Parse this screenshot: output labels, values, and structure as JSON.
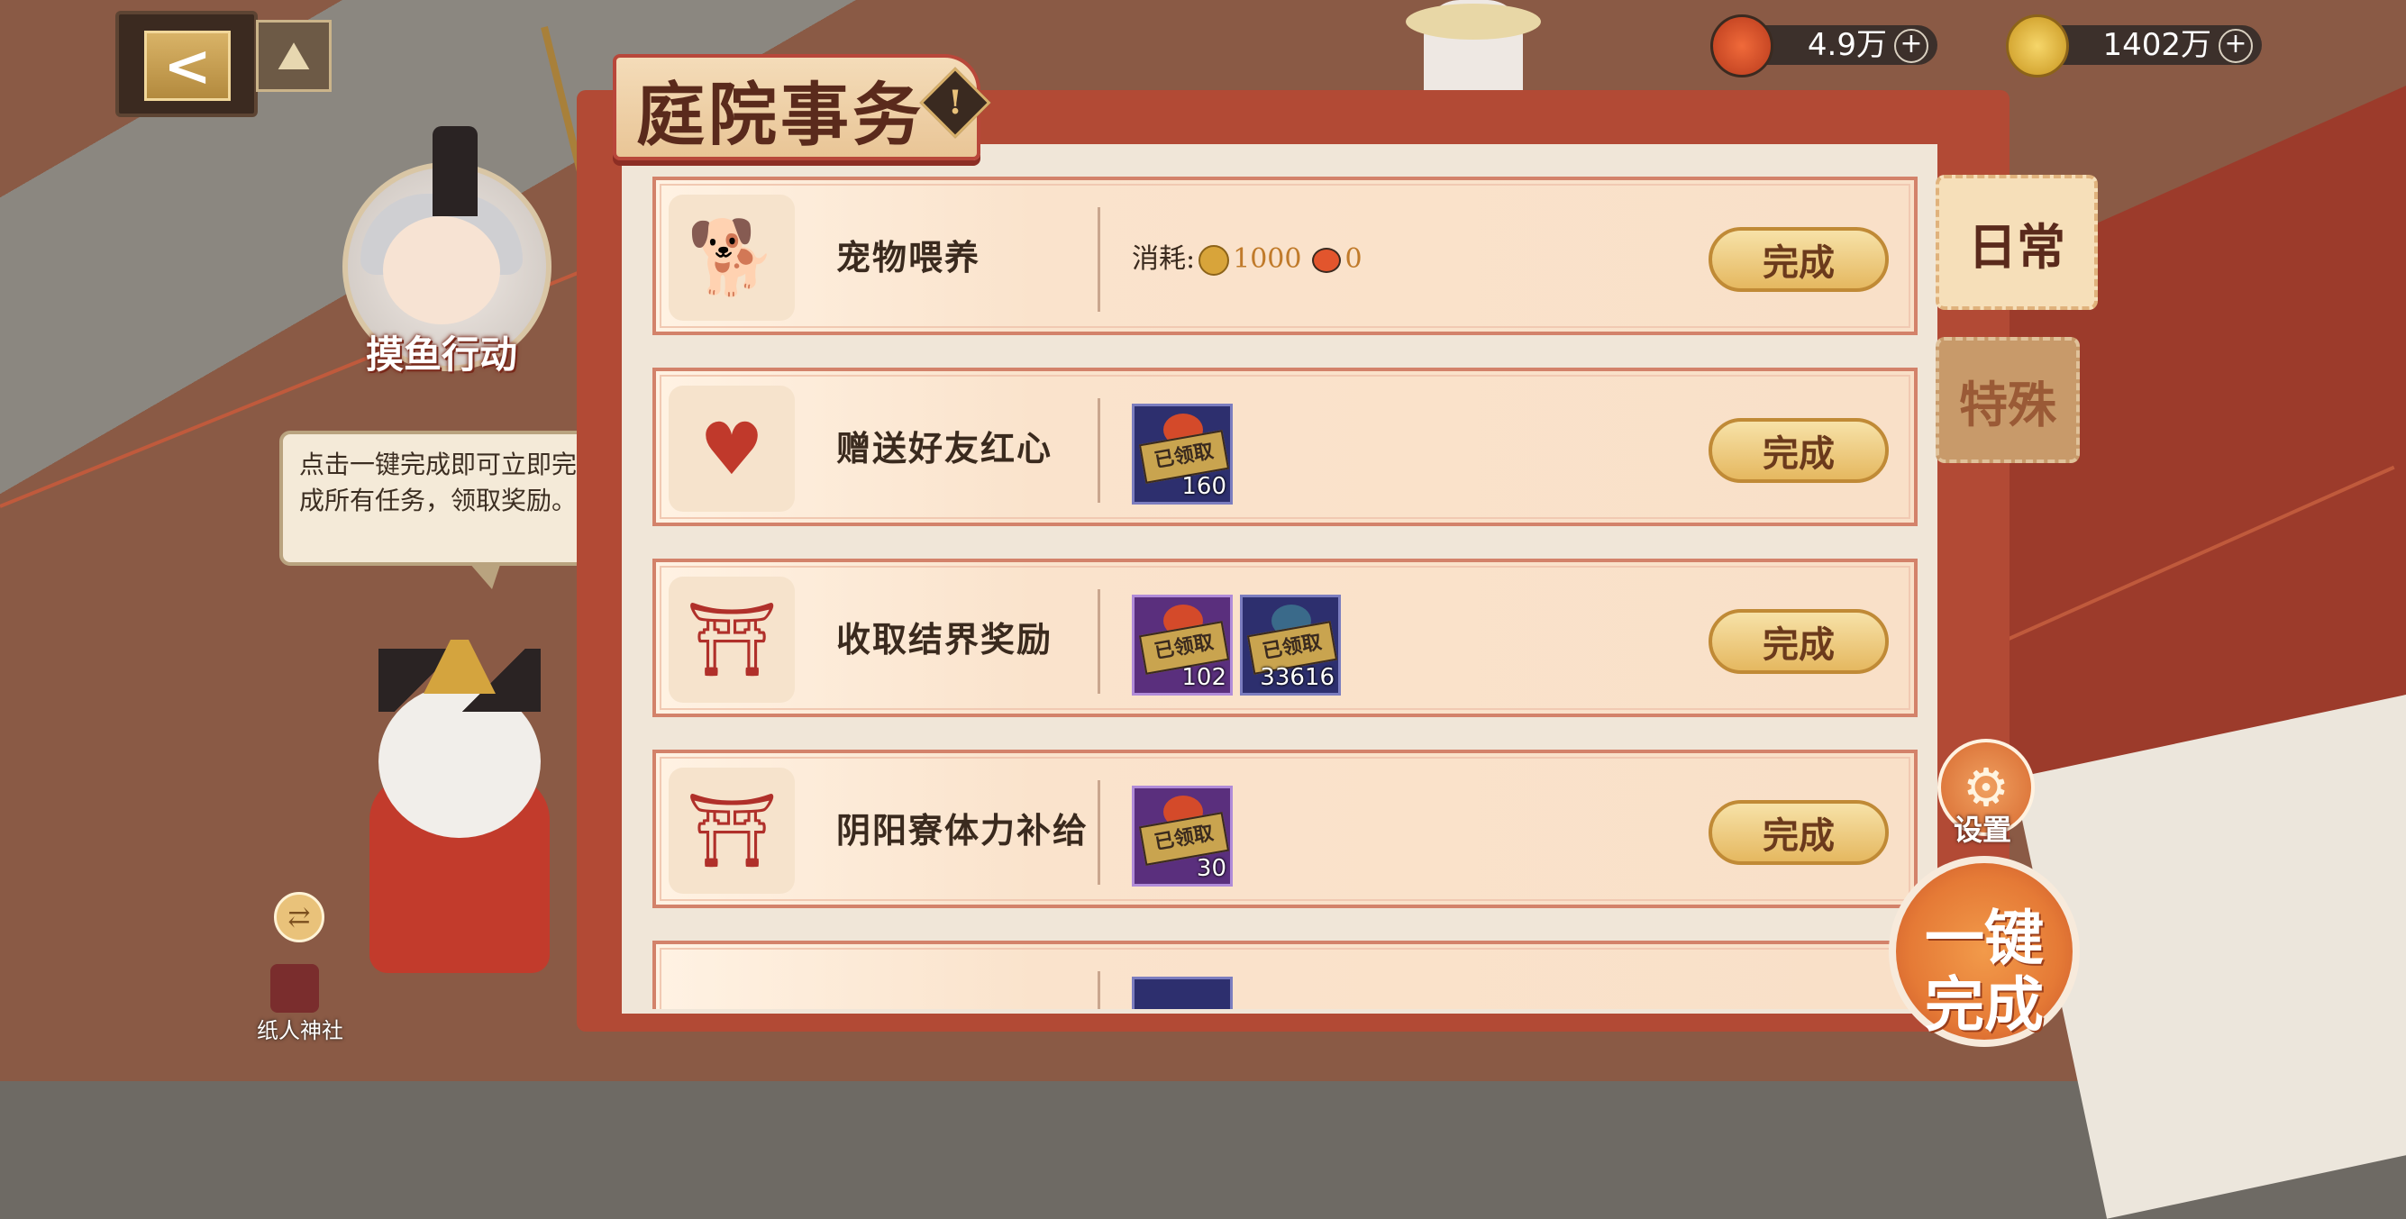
{
  "header": {
    "title": "庭院事务",
    "info_icon": "!",
    "back_icon": "<",
    "map_icon": "map-icon"
  },
  "currency": {
    "sushi": {
      "value": "4.9万",
      "plus": "+",
      "icon": "sushi-icon"
    },
    "coin": {
      "value": "1402万",
      "plus": "+",
      "icon": "coin-icon"
    }
  },
  "avatar": {
    "label": "摸鱼行动"
  },
  "tip": {
    "text": "点击一键完成即可立即完成所有任务，领取奖励。"
  },
  "shrine": {
    "label": "纸人神社",
    "swap_icon": "⇄"
  },
  "tabs": [
    {
      "label": "日常",
      "active": true
    },
    {
      "label": "特殊",
      "active": false
    }
  ],
  "tasks": [
    {
      "name": "宠物喂养",
      "icon": "dog-icon",
      "cost_label": "消耗:",
      "cost_coin": "1000",
      "cost_sushi": "0",
      "button": "完成"
    },
    {
      "name": "赠送好友红心",
      "icon": "heart-charm-icon",
      "rewards": [
        {
          "stamp": "已领取",
          "count": "160",
          "style": "blue"
        }
      ],
      "button": "完成"
    },
    {
      "name": "收取结界奖励",
      "icon": "barrier-icon",
      "rewards": [
        {
          "stamp": "已领取",
          "count": "102",
          "style": "purple"
        },
        {
          "stamp": "已领取",
          "count": "33616",
          "style": "blue"
        }
      ],
      "button": "完成"
    },
    {
      "name": "阴阳寮体力补给",
      "icon": "torii-icon",
      "rewards": [
        {
          "stamp": "已领取",
          "count": "30",
          "style": "purple"
        }
      ],
      "button": "完成"
    }
  ],
  "settings": {
    "label": "设置",
    "icon": "gear-icon"
  },
  "one_key": {
    "line1": "一键",
    "line2": "完成"
  },
  "colors": {
    "accent": "#e57a36",
    "book": "#b24a35",
    "button": "#e5b860"
  }
}
